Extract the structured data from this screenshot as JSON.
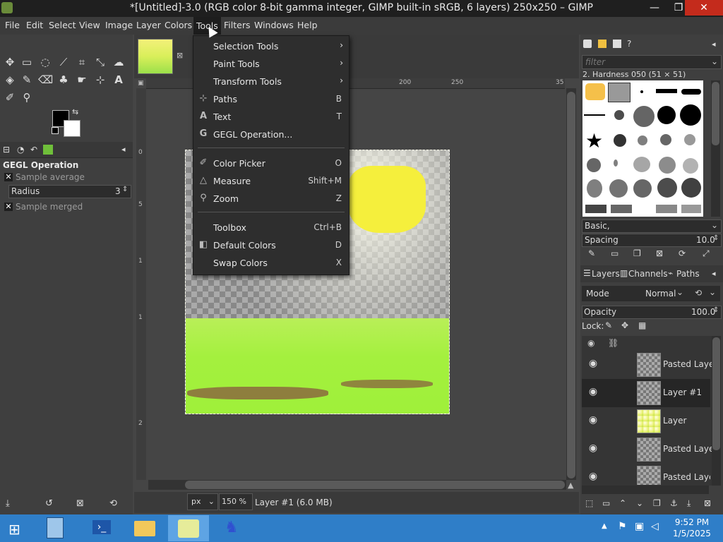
{
  "window": {
    "title": "*[Untitled]-3.0 (RGB color 8-bit gamma integer, GIMP built-in sRGB, 6 layers) 250x250 – GIMP",
    "minimize_icon": "minimize-icon",
    "maximize_icon": "restore-icon",
    "close_icon": "close-icon",
    "minimize_glyph": "—",
    "maximize_glyph": "❐",
    "close_glyph": "✕"
  },
  "menubar": {
    "items": [
      "File",
      "Edit",
      "Select",
      "View",
      "Image",
      "Layer",
      "Colors",
      "Tools",
      "Filters",
      "Windows",
      "Help"
    ],
    "open": "Tools"
  },
  "tools_menu": {
    "items": [
      {
        "label": "Selection Tools",
        "shortcut": "",
        "submenu": true,
        "icon": ""
      },
      {
        "label": "Paint Tools",
        "shortcut": "",
        "submenu": true,
        "icon": ""
      },
      {
        "label": "Transform Tools",
        "shortcut": "",
        "submenu": true,
        "icon": ""
      },
      {
        "label": "Paths",
        "shortcut": "B",
        "submenu": false,
        "icon": "paths-icon"
      },
      {
        "label": "Text",
        "shortcut": "T",
        "submenu": false,
        "icon": "text-icon"
      },
      {
        "label": "GEGL Operation...",
        "shortcut": "",
        "submenu": false,
        "icon": "gegl-icon"
      },
      {
        "label": "Color Picker",
        "shortcut": "O",
        "submenu": false,
        "icon": "color-picker-icon"
      },
      {
        "label": "Measure",
        "shortcut": "Shift+M",
        "submenu": false,
        "icon": "measure-icon"
      },
      {
        "label": "Zoom",
        "shortcut": "Z",
        "submenu": false,
        "icon": "zoom-icon"
      },
      {
        "label": "Toolbox",
        "shortcut": "Ctrl+B",
        "submenu": false,
        "icon": ""
      },
      {
        "label": "Default Colors",
        "shortcut": "D",
        "submenu": false,
        "icon": "default-colors-icon"
      },
      {
        "label": "Swap Colors",
        "shortcut": "X",
        "submenu": false,
        "icon": ""
      }
    ]
  },
  "tool_options": {
    "title": "GEGL Operation",
    "sample_average_label": "Sample average",
    "radius_label": "Radius",
    "radius_value": "3",
    "sample_merged_label": "Sample merged"
  },
  "rulers": {
    "h_ticks": [
      "200",
      "250",
      "35"
    ],
    "v_ticks": [
      "0",
      "5",
      "1",
      "1",
      "2"
    ]
  },
  "status": {
    "unit": "px",
    "zoom": "150 %",
    "layer_info": "Layer #1 (6.0 MB)"
  },
  "brushes": {
    "filter_placeholder": "filter",
    "current": "2. Hardness 050 (51 × 51)",
    "tag_value": "Basic,",
    "spacing_label": "Spacing",
    "spacing_value": "10.0"
  },
  "layers_panel": {
    "tabs": [
      "Layers",
      "Channels",
      "Paths"
    ],
    "mode_label": "Mode",
    "mode_value": "Normal",
    "opacity_label": "Opacity",
    "opacity_value": "100.0",
    "lock_label": "Lock:",
    "layers": [
      {
        "name": "Pasted Layer",
        "selected": false
      },
      {
        "name": "Layer #1",
        "selected": true
      },
      {
        "name": "Layer",
        "selected": false
      },
      {
        "name": "Pasted Layer",
        "selected": false
      },
      {
        "name": "Pasted Layer",
        "selected": false
      }
    ]
  },
  "taskbar": {
    "time": "9:52 PM",
    "date": "1/5/2025"
  }
}
